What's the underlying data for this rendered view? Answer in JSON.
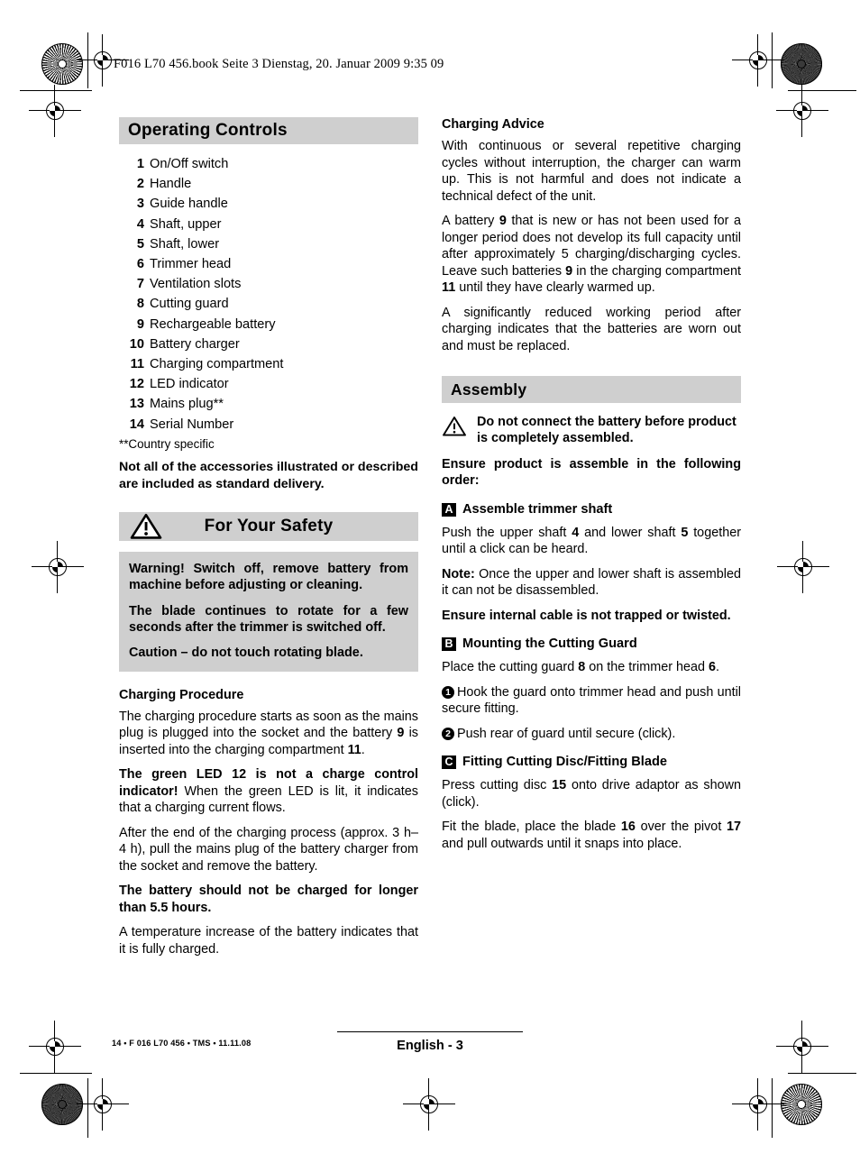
{
  "page": {
    "book_line": "F016 L70 456.book  Seite 3  Dienstag, 20. Januar 2009  9:35 09",
    "footer_left": "14 • F 016 L70 456 • TMS • 11.11.08",
    "footer_page": "English - 3"
  },
  "left_column": {
    "operating_controls": {
      "heading": "Operating Controls",
      "items": [
        {
          "num": "1",
          "label": "On/Off switch"
        },
        {
          "num": "2",
          "label": "Handle"
        },
        {
          "num": "3",
          "label": "Guide handle"
        },
        {
          "num": "4",
          "label": "Shaft, upper"
        },
        {
          "num": "5",
          "label": "Shaft, lower"
        },
        {
          "num": "6",
          "label": "Trimmer head"
        },
        {
          "num": "7",
          "label": "Ventilation slots"
        },
        {
          "num": "8",
          "label": "Cutting guard"
        },
        {
          "num": "9",
          "label": "Rechargeable battery"
        },
        {
          "num": "10",
          "label": "Battery charger"
        },
        {
          "num": "11",
          "label": "Charging compartment"
        },
        {
          "num": "12",
          "label": "LED indicator"
        },
        {
          "num": "13",
          "label": "Mains plug**"
        },
        {
          "num": "14",
          "label": "Serial Number"
        }
      ],
      "footnote": "**Country specific",
      "note_bold": "Not all of the accessories illustrated or described are included as standard delivery."
    },
    "for_your_safety": {
      "heading": "For Your Safety",
      "warning_icon": "warning-triangle-icon",
      "paragraphs": [
        "Warning! Switch off, remove battery from machine before adjusting or cleaning.",
        "The blade continues to rotate for a few seconds after the trimmer is switched off.",
        "Caution – do not touch rotating blade."
      ]
    },
    "charging_procedure": {
      "heading": "Charging Procedure",
      "p1_a": "The charging procedure starts as soon as the mains plug is plugged into the socket and the battery ",
      "p1_ref1": "9",
      "p1_b": " is inserted into the charging compartment ",
      "p1_ref2": "11",
      "p1_c": ".",
      "p2_bold": "The green LED 12 is not a charge control indicator!",
      "p2_rest": " When the green LED is lit, it indicates that a charging current flows.",
      "p3": "After the end of the charging process (approx. 3 h–4 h), pull the mains plug of the battery charger from the socket and remove the battery.",
      "p4_bold": "The battery should not be charged for longer than 5.5 hours.",
      "p5": "A temperature increase of the battery indicates that it is fully charged."
    }
  },
  "right_column": {
    "charging_advice": {
      "heading": "Charging Advice",
      "p1": "With continuous or several repetitive charging cycles without interruption, the charger can warm up. This is not harmful and does not indicate a technical defect of the unit.",
      "p2_a": "A battery ",
      "p2_ref1": "9",
      "p2_b": " that is new or has not been used for a longer period does not develop its full capacity until after approximately 5 charging/discharging cycles. Leave such batteries ",
      "p2_ref2": "9",
      "p2_c": " in the charging compartment ",
      "p2_ref3": "11",
      "p2_d": " until they have clearly warmed up.",
      "p3": "A significantly reduced working period after charging indicates that the batteries are worn out and must be replaced."
    },
    "assembly": {
      "heading": "Assembly",
      "warning_icon": "warning-triangle-icon",
      "warning_text": "Do not connect the battery before product is completely assembled.",
      "ensure_order": "Ensure product is assemble in the following order:",
      "step_a": {
        "letter": "A",
        "title": "Assemble trimmer shaft",
        "p1_a": "Push the upper shaft ",
        "p1_ref1": "4",
        "p1_b": " and lower shaft ",
        "p1_ref2": "5",
        "p1_c": " together until a click can be heard.",
        "note_label": "Note:",
        "note_rest": " Once the upper and lower shaft is assembled it can not be disassembled.",
        "ensure_cable": "Ensure internal cable is not trapped or twisted."
      },
      "step_b": {
        "letter": "B",
        "title": "Mounting the Cutting Guard",
        "p1_a": "Place the cutting guard ",
        "p1_ref1": "8",
        "p1_b": " on the trimmer head ",
        "p1_ref2": "6",
        "p1_c": ".",
        "bullet1_num": "1",
        "bullet1_text": "Hook the guard onto trimmer head and push until secure fitting.",
        "bullet2_num": "2",
        "bullet2_text": "Push rear of guard until secure (click)."
      },
      "step_c": {
        "letter": "C",
        "title": "Fitting Cutting Disc/Fitting Blade",
        "p1_a": "Press cutting disc ",
        "p1_ref1": "15",
        "p1_b": " onto drive adaptor as shown (click).",
        "p2_a": "Fit the blade, place the blade ",
        "p2_ref1": "16",
        "p2_b": " over the pivot ",
        "p2_ref2": "17",
        "p2_c": " and pull outwards until it snaps into place."
      }
    }
  },
  "print_marks": {
    "star_top_left": "registration-starburst",
    "star_top_right": "registration-starburst",
    "star_bottom_left": "registration-starburst",
    "star_bottom_right": "registration-starburst",
    "crosshairs": "registration-crosshair"
  },
  "colors": {
    "band_gray": "#cfcfcf",
    "text_black": "#000000",
    "page_white": "#ffffff"
  }
}
